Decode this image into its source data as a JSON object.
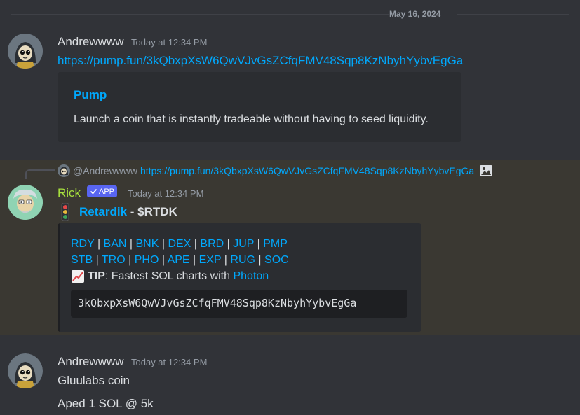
{
  "date_divider": "May 16, 2024",
  "messages": [
    {
      "username": "Andrewwww",
      "timestamp": "Today at 12:34 PM",
      "link": "https://pump.fun/3kQbxpXsW6QwVJvGsZCfqFMV48Sqp8KzNbyhYybvEgGa",
      "embed": {
        "title": "Pump",
        "description": "Launch a coin that is instantly tradeable without having to seed liquidity."
      }
    },
    {
      "reply": {
        "username": "@Andrewwww",
        "link": "https://pump.fun/3kQbxpXsW6QwVJvGsZCfqFMV48Sqp8KzNbyhYybvEgGa"
      },
      "username": "Rick",
      "bot_tag": "APP",
      "timestamp": "Today at 12:34 PM",
      "token_name": "Retardik",
      "token_sep": " - ",
      "token_symbol": "$RTDK",
      "links_row1": [
        "RDY",
        "BAN",
        "BNK",
        "DEX",
        "BRD",
        "JUP",
        "PMP"
      ],
      "links_row2": [
        "STB",
        "TRO",
        "PHO",
        "APE",
        "EXP",
        "RUG",
        "SOC"
      ],
      "tip_label": "TIP",
      "tip_text": ": Fastest SOL charts with ",
      "tip_link": "Photon",
      "contract": "3kQbxpXsW6QwVJvGsZCfqFMV48Sqp8KzNbyhYybvEgGa"
    },
    {
      "username": "Andrewwww",
      "timestamp": "Today at 12:34 PM",
      "lines": [
        "Gluulabs coin",
        "Aped 1 SOL @ 5k"
      ]
    }
  ],
  "colors": {
    "background": "#313338",
    "link": "#00a8fc",
    "rick_name": "#a7e03d",
    "highlight": "#3a3832",
    "bot_tag": "#5865f2"
  }
}
